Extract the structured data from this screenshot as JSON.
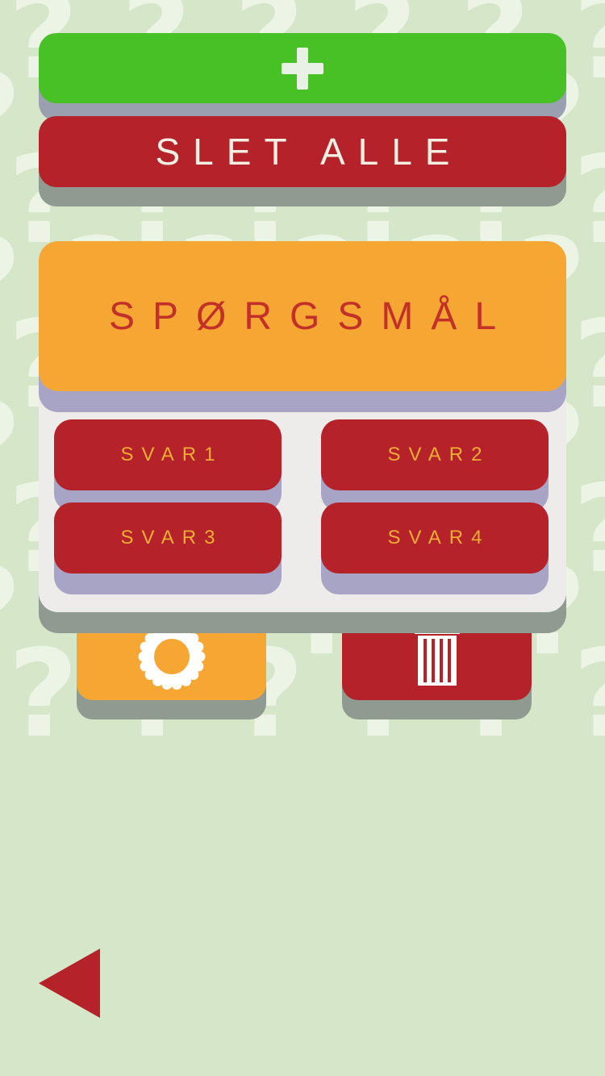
{
  "background": {
    "pattern_glyph": "?",
    "color": "#d6e6c8"
  },
  "toolbar": {
    "add_icon": "plus-icon",
    "clear_all_label": "SLET ALLE"
  },
  "question": {
    "label": "SPØRGSMÅL"
  },
  "answers": [
    {
      "label": "SVAR1"
    },
    {
      "label": "SVAR2"
    },
    {
      "label": "SVAR3"
    },
    {
      "label": "SVAR4"
    }
  ],
  "actions": {
    "settings_icon": "gear-icon",
    "delete_icon": "trash-icon"
  },
  "navigation": {
    "back_icon": "back-arrow-icon"
  },
  "colors": {
    "green": "#48c126",
    "red": "#b5222a",
    "orange": "#f6a733",
    "question_text": "#c3302a",
    "answer_text": "#f0ad33",
    "card": "#edeceb"
  }
}
